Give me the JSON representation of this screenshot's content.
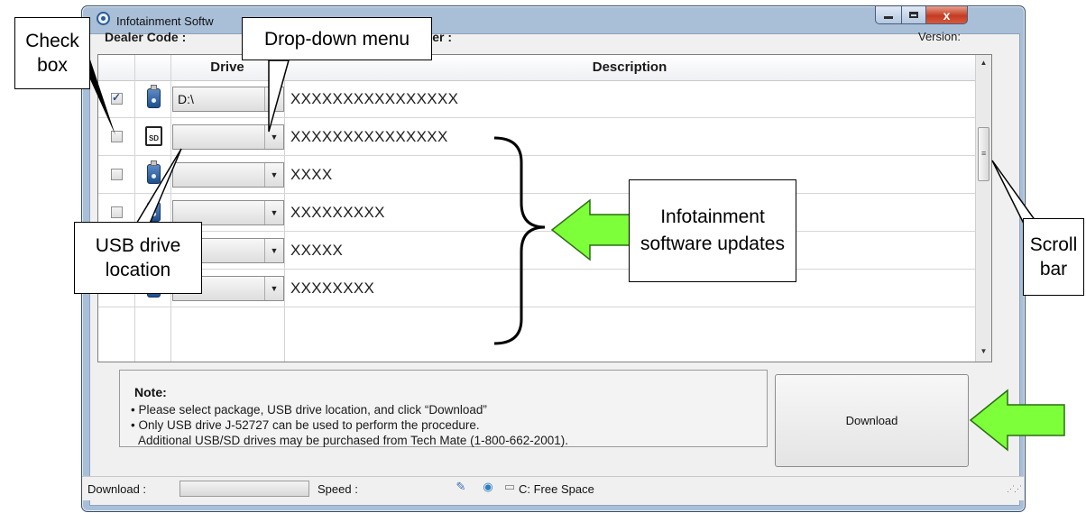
{
  "window": {
    "title": "Infotainment Softw",
    "close_glyph": "x"
  },
  "header": {
    "dealer_code_label": "Dealer Code :",
    "key_number_label": "Key Number :",
    "version_label": "Version:"
  },
  "grid": {
    "columns": [
      "Drive",
      "Description"
    ],
    "rows": [
      {
        "checked": true,
        "icon": "usb-drive-icon",
        "drive": "D:\\",
        "description": "XXXXXXXXXXXXXXXX"
      },
      {
        "checked": false,
        "icon": "sd-card-icon",
        "icon_text": "SD",
        "drive": "",
        "description": "XXXXXXXXXXXXXXX"
      },
      {
        "checked": false,
        "icon": "usb-drive-icon",
        "drive": "",
        "description": "XXXX"
      },
      {
        "checked": false,
        "icon": "usb-drive-icon",
        "drive": "",
        "description": "XXXXXXXXX"
      },
      {
        "checked": false,
        "icon": "usb-drive-icon",
        "drive": "",
        "description": "XXXXX"
      },
      {
        "checked": false,
        "icon": "usb-drive-icon",
        "drive": "",
        "description": "XXXXXXXX"
      }
    ]
  },
  "note": {
    "title": "Note:",
    "lines": [
      "• Please select package, USB drive location, and click “Download”",
      "• Only USB drive J-52727 can be used to perform the procedure.",
      "Additional USB/SD drives may be purchased from Tech Mate (1-800-662-2001)."
    ]
  },
  "download_button": "Download",
  "statusbar": {
    "download_label": "Download :",
    "speed_label": "Speed :",
    "free_space_label": "C: Free Space"
  },
  "callouts": {
    "check_box": "Check box",
    "drop_down": "Drop-down menu",
    "usb_location": "USB drive location",
    "updates": "Infotainment software updates",
    "scroll_bar": "Scroll bar"
  },
  "colors": {
    "arrow_fill": "#7dff3a",
    "window_frame": "#a9bfd8",
    "close_button": "#c43b22"
  }
}
